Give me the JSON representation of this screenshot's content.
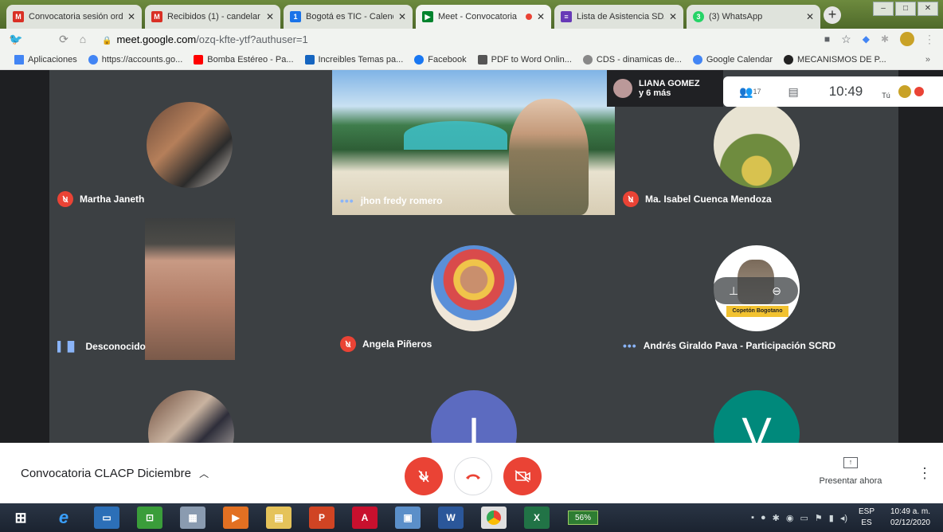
{
  "browser": {
    "tabs": [
      {
        "label": "Convocatoria sesión ord",
        "color": "#d93025",
        "glyph": "M"
      },
      {
        "label": "Recibidos (1) - candelar",
        "color": "#d93025",
        "glyph": "M"
      },
      {
        "label": "Bogotá es TIC - Calendar",
        "color": "#1a73e8",
        "glyph": "1"
      },
      {
        "label": "Meet - Convocatoria",
        "color": "#00832d",
        "glyph": "▶"
      },
      {
        "label": "Lista de Asistencia SDAC",
        "color": "#673ab7",
        "glyph": "≡"
      },
      {
        "label": "(3) WhatsApp",
        "color": "#25d366",
        "glyph": "3"
      }
    ],
    "close_glyph": "✕",
    "newtab_glyph": "+",
    "url_host": "meet.google.com",
    "url_path": "/ozq-kfte-ytf?authuser=1",
    "bookmarks": [
      {
        "label": "Aplicaciones",
        "color": "#4285f4"
      },
      {
        "label": "https://accounts.go...",
        "color": "#4285f4"
      },
      {
        "label": "Bomba Estéreo - Pa...",
        "color": "#ff0000"
      },
      {
        "label": "Increibles Temas pa...",
        "color": "#1565c0"
      },
      {
        "label": "Facebook",
        "color": "#1877f2"
      },
      {
        "label": "PDF to Word Onlin...",
        "color": "#555555"
      },
      {
        "label": "CDS - dinamicas de...",
        "color": "#888888"
      },
      {
        "label": "Google Calendar",
        "color": "#4285f4"
      },
      {
        "label": "MECANISMOS DE P...",
        "color": "#222222"
      }
    ],
    "bookmarks_more": "»"
  },
  "meet": {
    "participants": [
      {
        "name": "Martha Janeth",
        "state": "muted"
      },
      {
        "name": "jhon fredy romero",
        "state": "talking"
      },
      {
        "name": "Ma. Isabel Cuenca Mendoza",
        "state": "muted"
      },
      {
        "name": "Desconocido",
        "state": "speaking"
      },
      {
        "name": "Angela Piñeros",
        "state": "muted"
      },
      {
        "name": "Andrés Giraldo Pava - Participación SCRD",
        "state": "talking"
      }
    ],
    "bottom_row_letters": [
      "",
      "I",
      "V"
    ],
    "badge_text": "Copetón Bogotano",
    "top_user_name": "LIANA GOMEZ",
    "top_user_more": "y 6 más",
    "people_count": "17",
    "time": "10:49",
    "you_label": "Tú",
    "meeting_name": "Convocatoria CLACP Diciembre",
    "present_label": "Presentar ahora",
    "colors": {
      "mic_off": "#ea4335",
      "hangup": "#ea4335",
      "accent": "#8ab4f8"
    }
  },
  "taskbar": {
    "battery": "56%",
    "lang1": "ESP",
    "lang2": "ES",
    "clock_time": "10:49 a. m.",
    "clock_date": "02/12/2020"
  }
}
